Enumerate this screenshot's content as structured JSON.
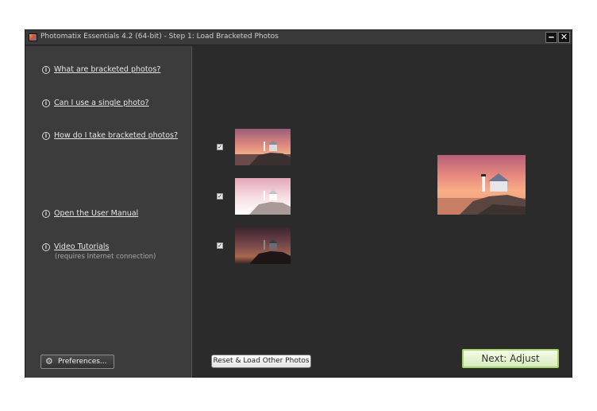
{
  "window": {
    "title": "Photomatix Essentials  4.2 (64-bit) - Step 1: Load Bracketed Photos",
    "minimize_symbol": "‒",
    "close_symbol": "✕"
  },
  "sidebar": {
    "info_symbol": "i",
    "items": [
      {
        "label": "What are bracketed photos?"
      },
      {
        "label": "Can I use a single photo?"
      },
      {
        "label": "How do I take bracketed photos?"
      },
      {
        "label": "Open the User Manual"
      },
      {
        "label": "Video Tutorials"
      }
    ],
    "video_note": "(requires Internet connection)",
    "preferences": {
      "label": "Preferences...",
      "icon": "gear-icon",
      "glyph": "⚙"
    }
  },
  "photos": {
    "check_symbol": "✓",
    "items": [
      {
        "checked": true,
        "exposure": "normal"
      },
      {
        "checked": true,
        "exposure": "over"
      },
      {
        "checked": true,
        "exposure": "under"
      }
    ]
  },
  "buttons": {
    "reset_label": "Reset & Load Other Photos",
    "next_label": "Next: Adjust"
  },
  "colors": {
    "background": "#2b2b2b",
    "sidebar": "#3c3c3c",
    "next_border": "#a9d26b"
  }
}
